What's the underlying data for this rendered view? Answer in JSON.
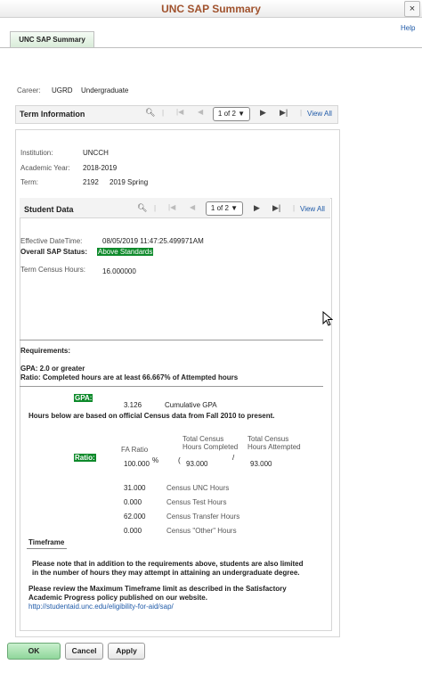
{
  "window": {
    "title": "UNC SAP Summary",
    "close": "×",
    "help": "Help"
  },
  "tab": "UNC SAP Summary",
  "career": {
    "label": "Career:",
    "code": "UGRD",
    "name": "Undergraduate"
  },
  "term_info": {
    "title": "Term Information",
    "pager": "1 of 2",
    "view_all": "View All",
    "institution_label": "Institution:",
    "institution": "UNCCH",
    "year_label": "Academic Year:",
    "year": "2018-2019",
    "term_label": "Term:",
    "term_code": "2192",
    "term_name": "2019 Spring"
  },
  "student_data": {
    "title": "Student Data",
    "pager": "1 of 2",
    "view_all": "View All",
    "eff_label": "Effective DateTime:",
    "eff_value": "08/05/2019 11:47:25.499971AM",
    "status_label": "Overall SAP Status:",
    "status_value": "Above Standards",
    "census_label": "Term Census Hours:",
    "census_value": "16.000000"
  },
  "requirements": {
    "title": "Requirements:",
    "gpa_req": "GPA: 2.0 or greater",
    "ratio_req": "Ratio: Completed hours are at least 66.667% of Attempted hours",
    "gpa_badge": "GPA:",
    "gpa_value": "3.126",
    "gpa_desc": "Cumulative GPA",
    "hours_note": "Hours below are based on official Census data from Fall 2010 to present.",
    "ratio_badge": "Ratio:",
    "fa_ratio_label": "FA Ratio",
    "fa_ratio": "100.000",
    "pct": "%",
    "completed_label_1": "Total Census",
    "completed_label_2": "Hours Completed",
    "attempted_label_1": "Total Census",
    "attempted_label_2": "Hours Attempted",
    "open_paren": "(",
    "slash": "/",
    "completed": "93.000",
    "attempted": "93.000",
    "hours": [
      {
        "value": "31.000",
        "label": "Census UNC Hours"
      },
      {
        "value": "0.000",
        "label": "Census Test Hours"
      },
      {
        "value": "62.000",
        "label": "Census Transfer Hours"
      },
      {
        "value": "0.000",
        "label": "Census \"Other\" Hours"
      }
    ]
  },
  "timeframe": {
    "title": "Timeframe",
    "note1a": "Please note that in addition to the requirements above, students are also limited",
    "note1b": "in the number of hours they may attempt in attaining an undergraduate degree.",
    "note2a": "Please review the Maximum Timeframe limit as described in the Satisfactory",
    "note2b": "Academic Progress policy published on our website.",
    "url": "http://studentaid.unc.edu/eligibility-for-aid/sap/"
  },
  "buttons": {
    "ok": "OK",
    "cancel": "Cancel",
    "apply": "Apply"
  }
}
